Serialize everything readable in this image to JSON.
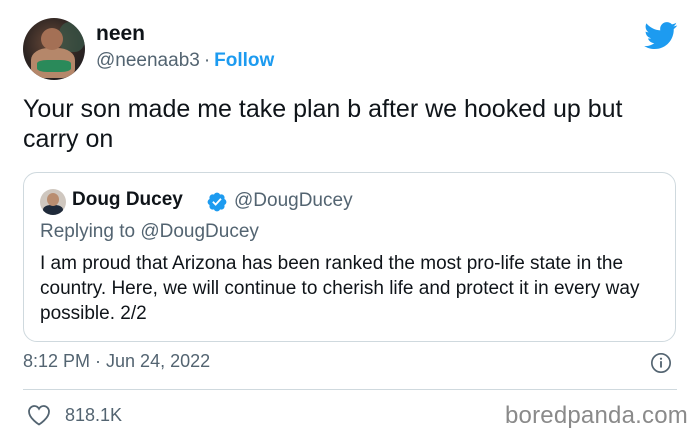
{
  "tweet": {
    "author": {
      "display_name": "neen",
      "handle": "@neenaab3",
      "separator": "·",
      "follow_label": "Follow"
    },
    "text": "Your son made me take plan b after we hooked up but carry on",
    "timestamp": "8:12 PM · Jun 24, 2022",
    "likes": "818.1K"
  },
  "quoted_tweet": {
    "display_name": "Doug Ducey",
    "handle": "@DougDucey",
    "replying_to": "Replying to @DougDucey",
    "text": "I am proud that Arizona has been ranked the most pro-life state in the country. Here, we will continue to cherish life and protect it in every way possible. 2/2"
  },
  "watermark": "boredpanda.com",
  "colors": {
    "accent": "#1d9bf0",
    "text": "#0f1419",
    "secondary_text": "#536471",
    "border": "#cfd9de"
  },
  "icons": {
    "brand": "twitter-bird-icon",
    "verified": "verified-badge-icon",
    "info": "info-icon",
    "like": "heart-icon"
  }
}
